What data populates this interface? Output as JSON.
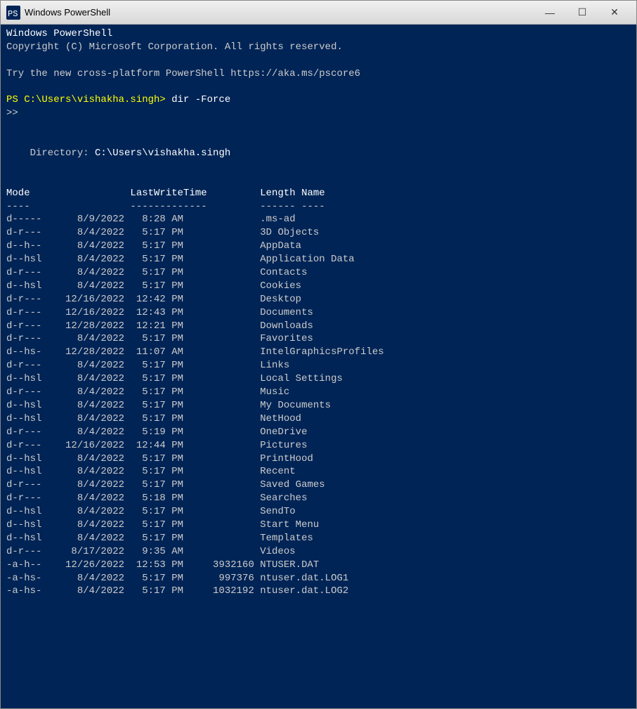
{
  "window": {
    "title": "Windows PowerShell",
    "minimize_label": "—",
    "maximize_label": "☐",
    "close_label": "✕"
  },
  "terminal": {
    "header_line1": "Windows PowerShell",
    "header_line2": "Copyright (C) Microsoft Corporation. All rights reserved.",
    "header_line3": "",
    "header_line4": "Try the new cross-platform PowerShell https://aka.ms/pscore6",
    "header_line5": "",
    "prompt": "PS C:\\Users\\vishakha.singh>",
    "command": " dir -Force",
    "prompt2": ">>",
    "directory_label": "    Directory: C:\\Users\\vishakha.singh",
    "columns": {
      "mode": "Mode",
      "lwt": "LastWriteTime",
      "length": "Length",
      "name": "Name"
    },
    "separator_mode": "----",
    "separator_lwt": "--------------",
    "separator_length": "------",
    "separator_name": "----",
    "entries": [
      {
        "mode": "d-----",
        "date": "8/9/2022",
        "time": "8:28 AM",
        "length": "",
        "name": ".ms-ad"
      },
      {
        "mode": "d-r---",
        "date": "8/4/2022",
        "time": "5:17 PM",
        "length": "",
        "name": "3D Objects"
      },
      {
        "mode": "d--h--",
        "date": "8/4/2022",
        "time": "5:17 PM",
        "length": "",
        "name": "AppData"
      },
      {
        "mode": "d--hsl",
        "date": "8/4/2022",
        "time": "5:17 PM",
        "length": "",
        "name": "Application Data"
      },
      {
        "mode": "d-r---",
        "date": "8/4/2022",
        "time": "5:17 PM",
        "length": "",
        "name": "Contacts"
      },
      {
        "mode": "d--hsl",
        "date": "8/4/2022",
        "time": "5:17 PM",
        "length": "",
        "name": "Cookies"
      },
      {
        "mode": "d-r---",
        "date": "12/16/2022",
        "time": "12:42 PM",
        "length": "",
        "name": "Desktop"
      },
      {
        "mode": "d-r---",
        "date": "12/16/2022",
        "time": "12:43 PM",
        "length": "",
        "name": "Documents"
      },
      {
        "mode": "d-r---",
        "date": "12/28/2022",
        "time": "12:21 PM",
        "length": "",
        "name": "Downloads"
      },
      {
        "mode": "d-r---",
        "date": "8/4/2022",
        "time": "5:17 PM",
        "length": "",
        "name": "Favorites"
      },
      {
        "mode": "d--hs-",
        "date": "12/28/2022",
        "time": "11:07 AM",
        "length": "",
        "name": "IntelGraphicsProfiles"
      },
      {
        "mode": "d-r---",
        "date": "8/4/2022",
        "time": "5:17 PM",
        "length": "",
        "name": "Links"
      },
      {
        "mode": "d--hsl",
        "date": "8/4/2022",
        "time": "5:17 PM",
        "length": "",
        "name": "Local Settings"
      },
      {
        "mode": "d-r---",
        "date": "8/4/2022",
        "time": "5:17 PM",
        "length": "",
        "name": "Music"
      },
      {
        "mode": "d--hsl",
        "date": "8/4/2022",
        "time": "5:17 PM",
        "length": "",
        "name": "My Documents"
      },
      {
        "mode": "d--hsl",
        "date": "8/4/2022",
        "time": "5:17 PM",
        "length": "",
        "name": "NetHood"
      },
      {
        "mode": "d-r---",
        "date": "8/4/2022",
        "time": "5:19 PM",
        "length": "",
        "name": "OneDrive"
      },
      {
        "mode": "d-r---",
        "date": "12/16/2022",
        "time": "12:44 PM",
        "length": "",
        "name": "Pictures"
      },
      {
        "mode": "d--hsl",
        "date": "8/4/2022",
        "time": "5:17 PM",
        "length": "",
        "name": "PrintHood"
      },
      {
        "mode": "d--hsl",
        "date": "8/4/2022",
        "time": "5:17 PM",
        "length": "",
        "name": "Recent"
      },
      {
        "mode": "d-r---",
        "date": "8/4/2022",
        "time": "5:17 PM",
        "length": "",
        "name": "Saved Games"
      },
      {
        "mode": "d-r---",
        "date": "8/4/2022",
        "time": "5:18 PM",
        "length": "",
        "name": "Searches"
      },
      {
        "mode": "d--hsl",
        "date": "8/4/2022",
        "time": "5:17 PM",
        "length": "",
        "name": "SendTo"
      },
      {
        "mode": "d--hsl",
        "date": "8/4/2022",
        "time": "5:17 PM",
        "length": "",
        "name": "Start Menu"
      },
      {
        "mode": "d--hsl",
        "date": "8/4/2022",
        "time": "5:17 PM",
        "length": "",
        "name": "Templates"
      },
      {
        "mode": "d-r---",
        "date": "8/17/2022",
        "time": "9:35 AM",
        "length": "",
        "name": "Videos"
      },
      {
        "mode": "-a-h--",
        "date": "12/26/2022",
        "time": "12:53 PM",
        "length": "3932160",
        "name": "NTUSER.DAT"
      },
      {
        "mode": "-a-hs-",
        "date": "8/4/2022",
        "time": "5:17 PM",
        "length": "997376",
        "name": "ntuser.dat.LOG1"
      },
      {
        "mode": "-a-hs-",
        "date": "8/4/2022",
        "time": "5:17 PM",
        "length": "1032192",
        "name": "ntuser.dat.LOG2"
      }
    ]
  }
}
